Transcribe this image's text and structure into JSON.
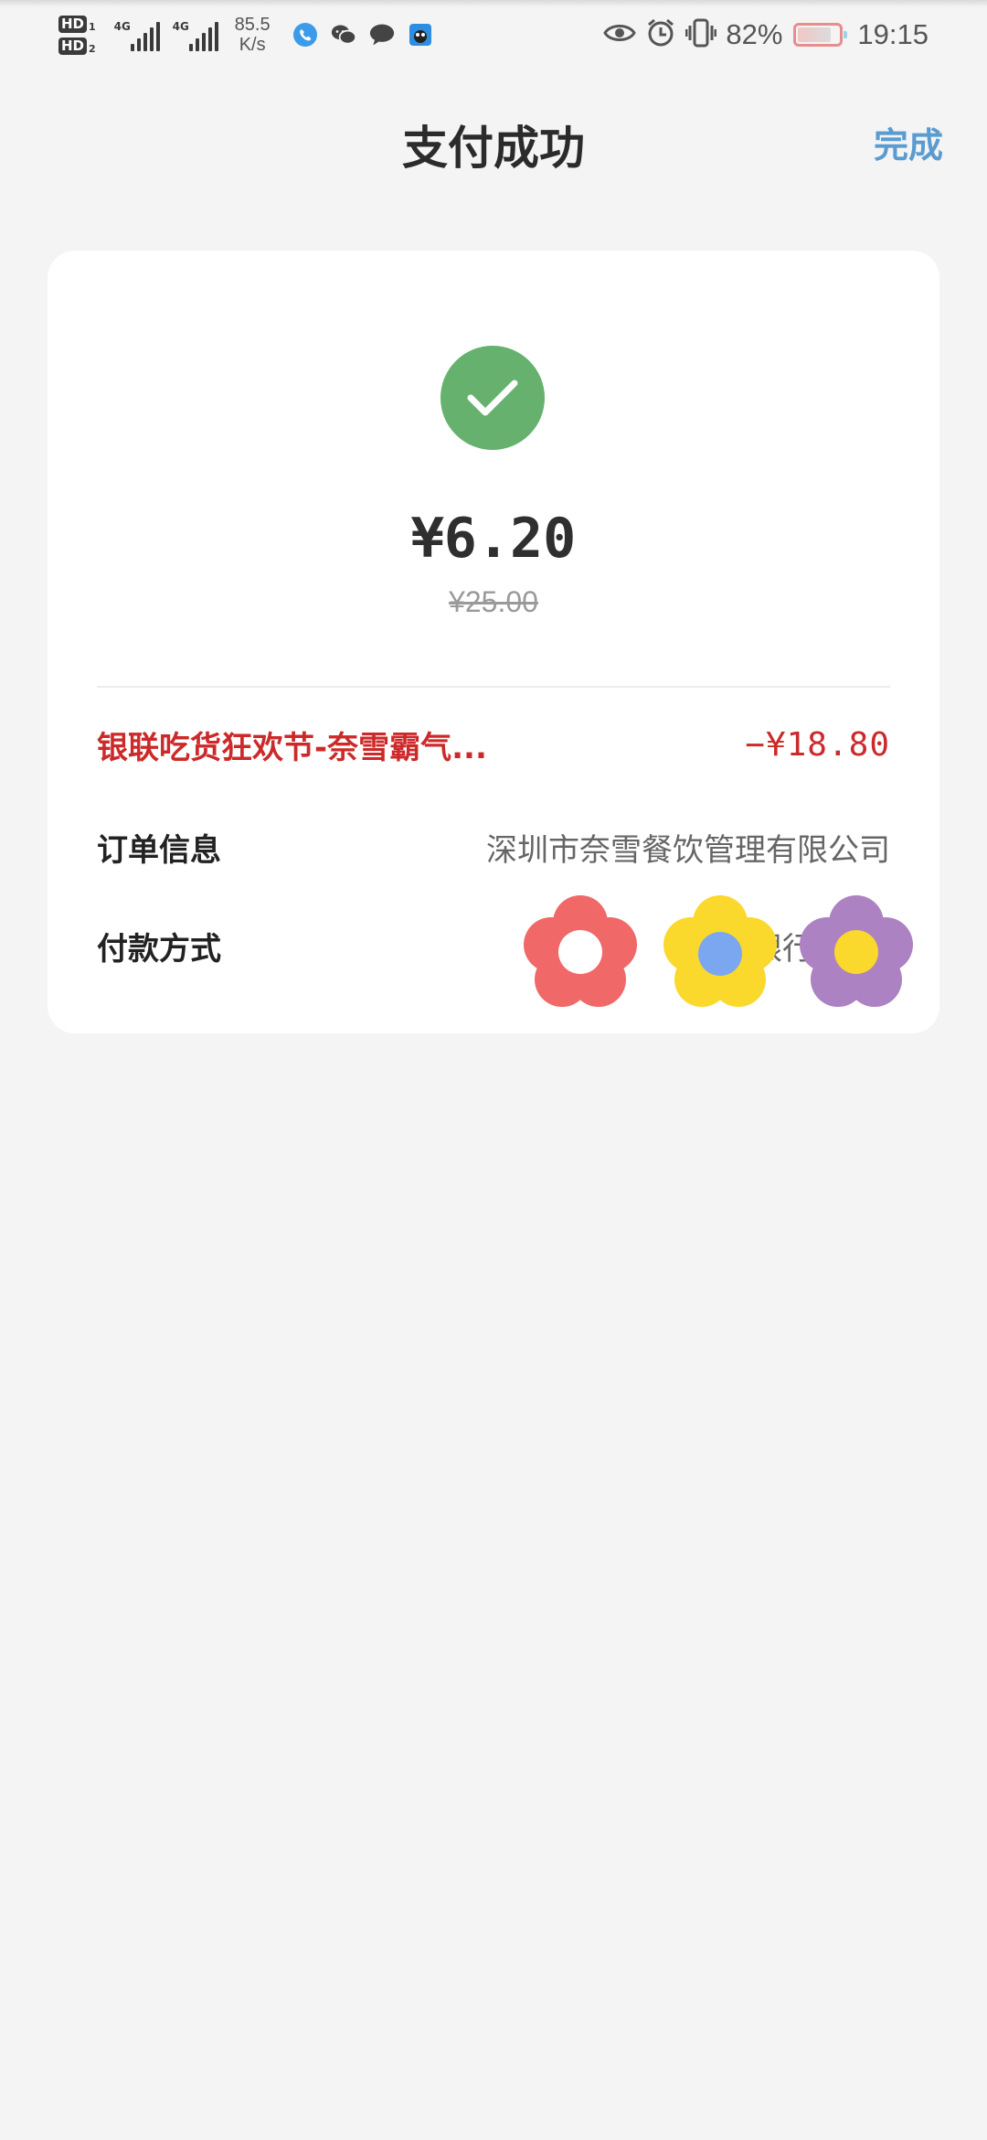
{
  "status_bar": {
    "hd1": "HD",
    "hd1_sub": "1",
    "hd2": "HD",
    "hd2_sub": "2",
    "sig1_tag": "4G",
    "sig2_tag": "4G",
    "net_speed_value": "85.5",
    "net_speed_unit": "K/s",
    "icons": [
      "phone-icon",
      "wechat-icon",
      "message-icon",
      "app-icon"
    ],
    "right_icons": [
      "eye-icon",
      "alarm-icon",
      "vibrate-icon"
    ],
    "battery_percent": "82%",
    "battery_level": 0.82,
    "time": "19:15"
  },
  "header": {
    "title": "支付成功",
    "done_label": "完成"
  },
  "payment": {
    "amount": "¥6.20",
    "original_amount": "¥25.00",
    "discount_name": "银联吃货狂欢节-奈雪霸气...",
    "discount_amount": "−¥18.80",
    "order_label": "订单信息",
    "order_value": "深圳市奈雪餐饮管理有限公司",
    "payment_label": "付款方式",
    "payment_value_visible": "银行 ["
  },
  "overlay": {
    "flowers": [
      "red-flower",
      "yellow-flower",
      "purple-flower"
    ]
  },
  "colors": {
    "success_green": "#65b16d",
    "discount_red": "#cc2a2a",
    "link_blue": "#5a9bd0",
    "background": "#f4f4f5"
  }
}
